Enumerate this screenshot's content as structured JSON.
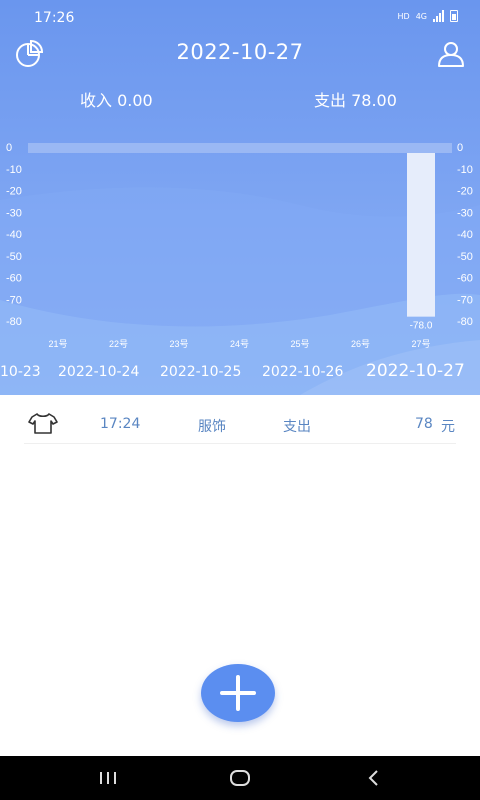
{
  "status": {
    "time": "17:26",
    "hd": "HD",
    "net": "4G"
  },
  "header": {
    "date": "2022-10-27",
    "income": "收入 0.00",
    "expense": "支出 78.00"
  },
  "icons": {
    "left": "pie-chart-icon",
    "right": "user-icon"
  },
  "chart_data": {
    "type": "bar",
    "categories": [
      "21号",
      "22号",
      "23号",
      "24号",
      "25号",
      "26号",
      "27号"
    ],
    "values": [
      0,
      0,
      0,
      0,
      0,
      0,
      -78.0
    ],
    "value_labels": [
      "",
      "",
      "",
      "",
      "",
      "",
      "-78.0"
    ],
    "yticks": [
      "0",
      "-10",
      "-20",
      "-30",
      "-40",
      "-50",
      "-60",
      "-70",
      "-80"
    ],
    "ylim": [
      -80,
      0
    ]
  },
  "date_strip": [
    {
      "label": "10-23",
      "selected": false
    },
    {
      "label": "2022-10-24",
      "selected": false
    },
    {
      "label": "2022-10-25",
      "selected": false
    },
    {
      "label": "2022-10-26",
      "selected": false
    },
    {
      "label": "2022-10-27",
      "selected": true
    }
  ],
  "records": [
    {
      "icon": "tshirt-icon",
      "time": "17:24",
      "category": "服饰",
      "type": "支出",
      "amount": "78",
      "unit": "元"
    }
  ],
  "colors": {
    "accent": "#5b8ef0",
    "record_text": "#5a86c2",
    "bar": "#e6edfb"
  }
}
